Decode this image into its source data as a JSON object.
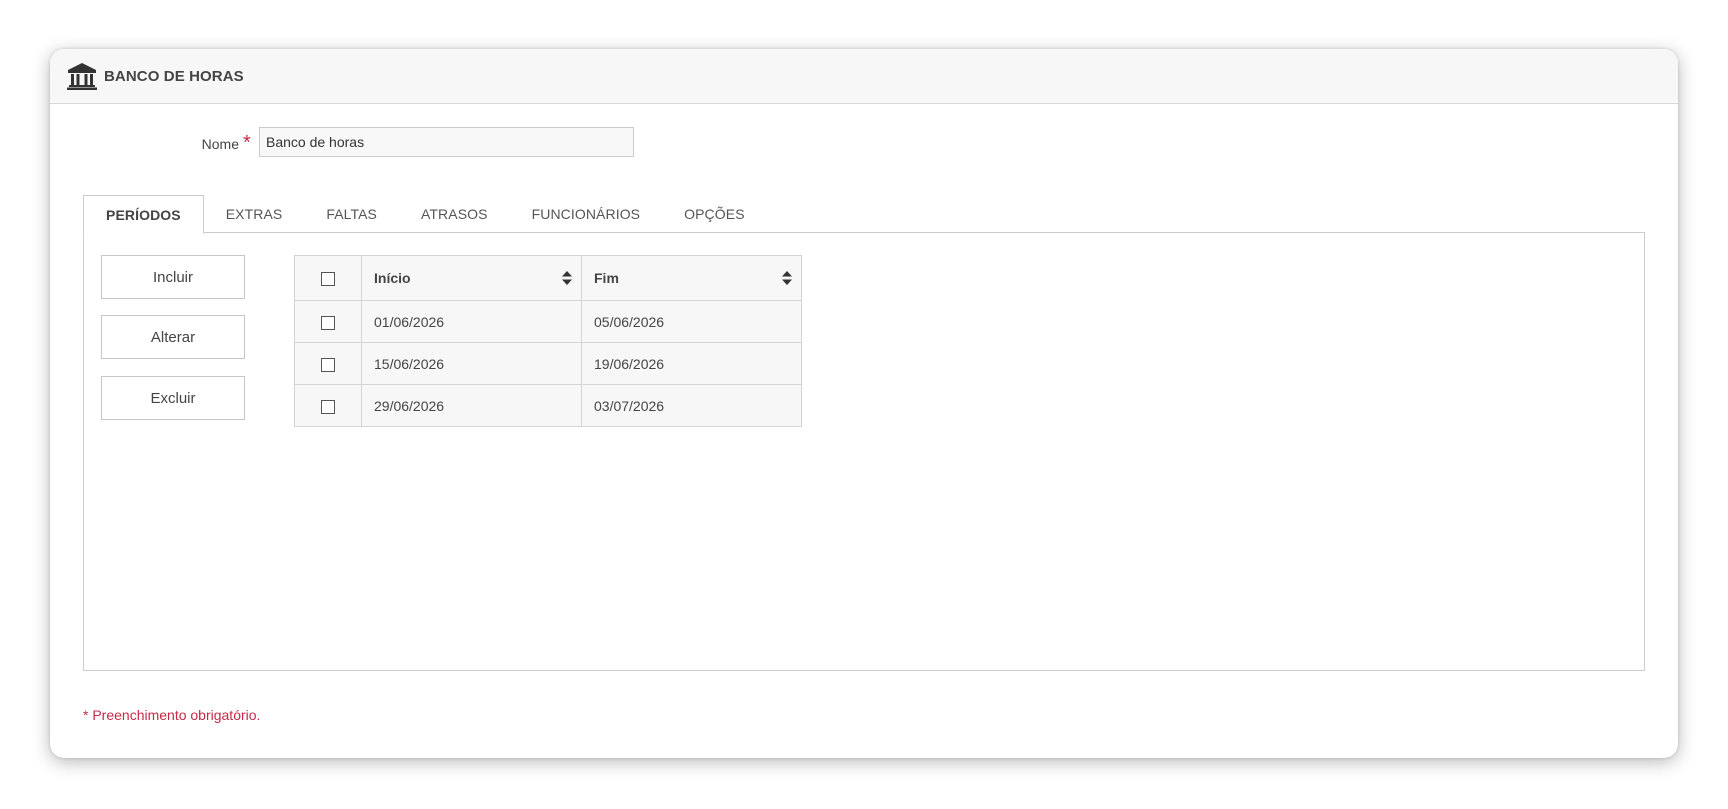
{
  "window": {
    "title": "BANCO DE HORAS",
    "icon": "bank-icon"
  },
  "form": {
    "name_label": "Nome",
    "required_marker": "*",
    "name_value": "Banco de horas"
  },
  "tabs": [
    {
      "label": "PERÍODOS",
      "active": true
    },
    {
      "label": "EXTRAS",
      "active": false
    },
    {
      "label": "FALTAS",
      "active": false
    },
    {
      "label": "ATRASOS",
      "active": false
    },
    {
      "label": "FUNCIONÁRIOS",
      "active": false
    },
    {
      "label": "OPÇÕES",
      "active": false
    }
  ],
  "actions": {
    "add_label": "Incluir",
    "edit_label": "Alterar",
    "delete_label": "Excluir"
  },
  "table": {
    "columns": [
      "Início",
      "Fim"
    ],
    "rows": [
      {
        "inicio": "01/06/2026",
        "fim": "05/06/2026"
      },
      {
        "inicio": "15/06/2026",
        "fim": "19/06/2026"
      },
      {
        "inicio": "29/06/2026",
        "fim": "03/07/2026"
      }
    ]
  },
  "footer": {
    "required_note": "* Preenchimento obrigatório."
  },
  "colors": {
    "accent_required": "#c62a47",
    "header_bg": "#f7f7f8",
    "border": "#cccccc"
  }
}
